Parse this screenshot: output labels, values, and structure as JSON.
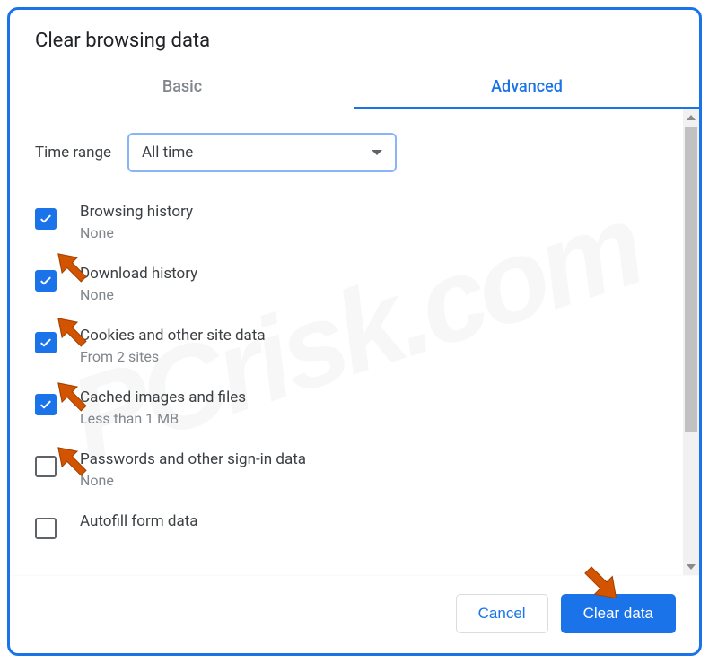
{
  "dialog": {
    "title": "Clear browsing data"
  },
  "tabs": {
    "basic": "Basic",
    "advanced": "Advanced",
    "active": "advanced"
  },
  "time_range": {
    "label": "Time range",
    "value": "All time"
  },
  "options": [
    {
      "title": "Browsing history",
      "subtitle": "None",
      "checked": true
    },
    {
      "title": "Download history",
      "subtitle": "None",
      "checked": true
    },
    {
      "title": "Cookies and other site data",
      "subtitle": "From 2 sites",
      "checked": true
    },
    {
      "title": "Cached images and files",
      "subtitle": "Less than 1 MB",
      "checked": true
    },
    {
      "title": "Passwords and other sign-in data",
      "subtitle": "None",
      "checked": false
    },
    {
      "title": "Autofill form data",
      "subtitle": "",
      "checked": false
    }
  ],
  "buttons": {
    "cancel": "Cancel",
    "clear": "Clear data"
  },
  "annotation_arrow_color": "#d35400",
  "watermark_text": "PCrisk.com"
}
